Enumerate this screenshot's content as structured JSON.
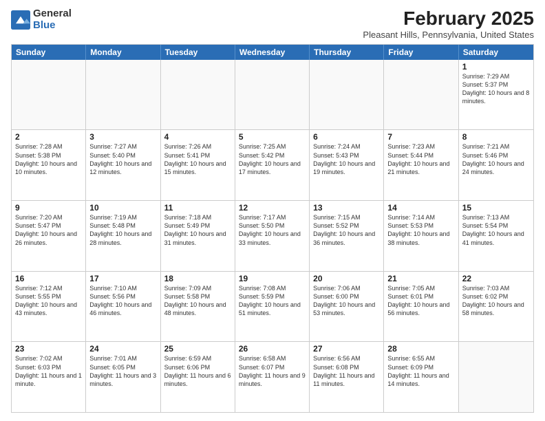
{
  "header": {
    "logo": {
      "general": "General",
      "blue": "Blue"
    },
    "title": "February 2025",
    "location": "Pleasant Hills, Pennsylvania, United States"
  },
  "dayHeaders": [
    "Sunday",
    "Monday",
    "Tuesday",
    "Wednesday",
    "Thursday",
    "Friday",
    "Saturday"
  ],
  "weeks": [
    [
      {
        "num": "",
        "info": ""
      },
      {
        "num": "",
        "info": ""
      },
      {
        "num": "",
        "info": ""
      },
      {
        "num": "",
        "info": ""
      },
      {
        "num": "",
        "info": ""
      },
      {
        "num": "",
        "info": ""
      },
      {
        "num": "1",
        "info": "Sunrise: 7:29 AM\nSunset: 5:37 PM\nDaylight: 10 hours and 8 minutes."
      }
    ],
    [
      {
        "num": "2",
        "info": "Sunrise: 7:28 AM\nSunset: 5:38 PM\nDaylight: 10 hours and 10 minutes."
      },
      {
        "num": "3",
        "info": "Sunrise: 7:27 AM\nSunset: 5:40 PM\nDaylight: 10 hours and 12 minutes."
      },
      {
        "num": "4",
        "info": "Sunrise: 7:26 AM\nSunset: 5:41 PM\nDaylight: 10 hours and 15 minutes."
      },
      {
        "num": "5",
        "info": "Sunrise: 7:25 AM\nSunset: 5:42 PM\nDaylight: 10 hours and 17 minutes."
      },
      {
        "num": "6",
        "info": "Sunrise: 7:24 AM\nSunset: 5:43 PM\nDaylight: 10 hours and 19 minutes."
      },
      {
        "num": "7",
        "info": "Sunrise: 7:23 AM\nSunset: 5:44 PM\nDaylight: 10 hours and 21 minutes."
      },
      {
        "num": "8",
        "info": "Sunrise: 7:21 AM\nSunset: 5:46 PM\nDaylight: 10 hours and 24 minutes."
      }
    ],
    [
      {
        "num": "9",
        "info": "Sunrise: 7:20 AM\nSunset: 5:47 PM\nDaylight: 10 hours and 26 minutes."
      },
      {
        "num": "10",
        "info": "Sunrise: 7:19 AM\nSunset: 5:48 PM\nDaylight: 10 hours and 28 minutes."
      },
      {
        "num": "11",
        "info": "Sunrise: 7:18 AM\nSunset: 5:49 PM\nDaylight: 10 hours and 31 minutes."
      },
      {
        "num": "12",
        "info": "Sunrise: 7:17 AM\nSunset: 5:50 PM\nDaylight: 10 hours and 33 minutes."
      },
      {
        "num": "13",
        "info": "Sunrise: 7:15 AM\nSunset: 5:52 PM\nDaylight: 10 hours and 36 minutes."
      },
      {
        "num": "14",
        "info": "Sunrise: 7:14 AM\nSunset: 5:53 PM\nDaylight: 10 hours and 38 minutes."
      },
      {
        "num": "15",
        "info": "Sunrise: 7:13 AM\nSunset: 5:54 PM\nDaylight: 10 hours and 41 minutes."
      }
    ],
    [
      {
        "num": "16",
        "info": "Sunrise: 7:12 AM\nSunset: 5:55 PM\nDaylight: 10 hours and 43 minutes."
      },
      {
        "num": "17",
        "info": "Sunrise: 7:10 AM\nSunset: 5:56 PM\nDaylight: 10 hours and 46 minutes."
      },
      {
        "num": "18",
        "info": "Sunrise: 7:09 AM\nSunset: 5:58 PM\nDaylight: 10 hours and 48 minutes."
      },
      {
        "num": "19",
        "info": "Sunrise: 7:08 AM\nSunset: 5:59 PM\nDaylight: 10 hours and 51 minutes."
      },
      {
        "num": "20",
        "info": "Sunrise: 7:06 AM\nSunset: 6:00 PM\nDaylight: 10 hours and 53 minutes."
      },
      {
        "num": "21",
        "info": "Sunrise: 7:05 AM\nSunset: 6:01 PM\nDaylight: 10 hours and 56 minutes."
      },
      {
        "num": "22",
        "info": "Sunrise: 7:03 AM\nSunset: 6:02 PM\nDaylight: 10 hours and 58 minutes."
      }
    ],
    [
      {
        "num": "23",
        "info": "Sunrise: 7:02 AM\nSunset: 6:03 PM\nDaylight: 11 hours and 1 minute."
      },
      {
        "num": "24",
        "info": "Sunrise: 7:01 AM\nSunset: 6:05 PM\nDaylight: 11 hours and 3 minutes."
      },
      {
        "num": "25",
        "info": "Sunrise: 6:59 AM\nSunset: 6:06 PM\nDaylight: 11 hours and 6 minutes."
      },
      {
        "num": "26",
        "info": "Sunrise: 6:58 AM\nSunset: 6:07 PM\nDaylight: 11 hours and 9 minutes."
      },
      {
        "num": "27",
        "info": "Sunrise: 6:56 AM\nSunset: 6:08 PM\nDaylight: 11 hours and 11 minutes."
      },
      {
        "num": "28",
        "info": "Sunrise: 6:55 AM\nSunset: 6:09 PM\nDaylight: 11 hours and 14 minutes."
      },
      {
        "num": "",
        "info": ""
      }
    ]
  ]
}
